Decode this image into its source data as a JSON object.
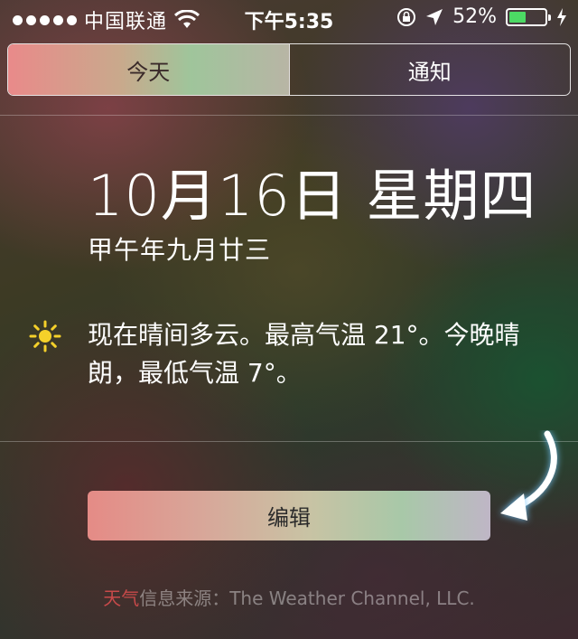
{
  "status_bar": {
    "carrier": "中国联通",
    "time": "下午5:35",
    "battery_percent": "52%",
    "battery_level": 0.52,
    "signal_dots": 5
  },
  "tabs": [
    {
      "label": "今天",
      "selected": true
    },
    {
      "label": "通知",
      "selected": false
    }
  ],
  "today": {
    "date": "10月16日 星期四",
    "lunar_date": "甲午年九月廿三",
    "weather_icon": "sun-icon",
    "weather_summary": "现在晴间多云。最高气温 21°。今晚晴朗，最低气温 7°。"
  },
  "edit_button": "编辑",
  "footer": {
    "link_text": "天气",
    "source_text": "信息来源：The Weather Channel, LLC."
  },
  "colors": {
    "battery": "#4cd964",
    "link": "#c84a4a"
  }
}
